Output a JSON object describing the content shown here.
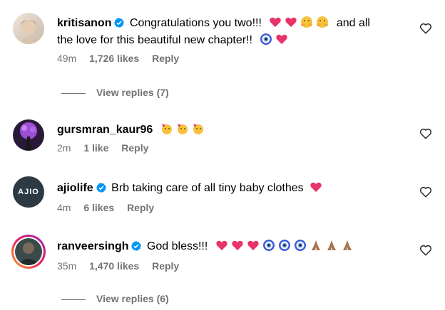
{
  "comments": [
    {
      "username": "kritisanon",
      "verified": true,
      "text_line1": "Congratulations you two!!!",
      "text_after_emojis": "and all",
      "text_line2": "the love for this beautiful new chapter!!",
      "time": "49m",
      "likes": "1,726 likes",
      "reply": "Reply",
      "view_replies": "View replies (7)"
    },
    {
      "username": "gursmran_kaur96",
      "verified": false,
      "time": "2m",
      "likes": "1 like",
      "reply": "Reply"
    },
    {
      "username": "ajiolife",
      "verified": true,
      "text": "Brb taking care of all tiny baby clothes",
      "avatar_text": "AJIO",
      "time": "4m",
      "likes": "6 likes",
      "reply": "Reply"
    },
    {
      "username": "ranveersingh",
      "verified": true,
      "text": "God bless!!!",
      "time": "35m",
      "likes": "1,470 likes",
      "reply": "Reply",
      "view_replies": "View replies (6)"
    }
  ],
  "colors": {
    "accent": "#0095f6",
    "muted": "#737373",
    "heart_emoji": "#e8336b"
  },
  "icons": [
    "verified-badge-icon",
    "like-heart-icon",
    "heart-emoji-icon",
    "hug-emoji-icon",
    "evil-eye-icon",
    "party-face-icon",
    "praying-hands-icon"
  ]
}
